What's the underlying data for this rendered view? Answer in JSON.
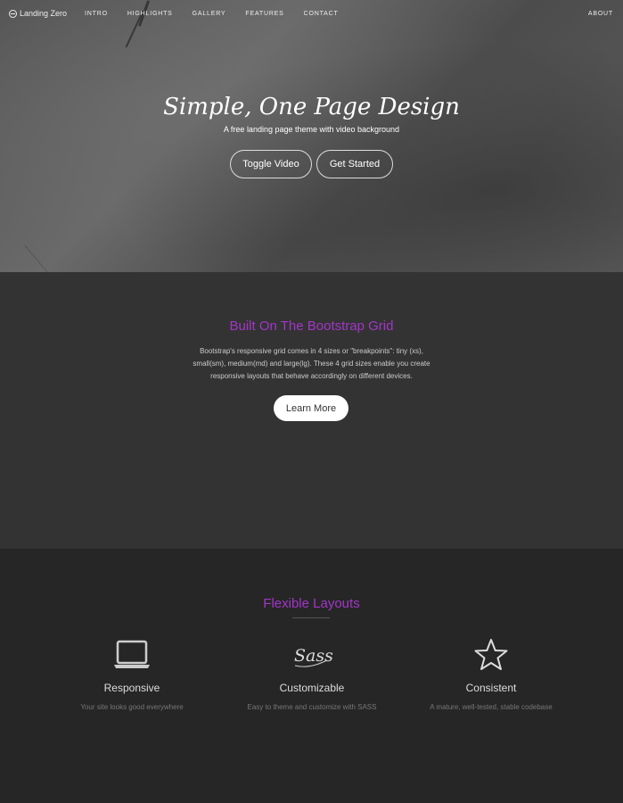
{
  "navbar": {
    "brand": "Landing Zero",
    "links": [
      "INTRO",
      "HIGHLIGHTS",
      "GALLERY",
      "FEATURES",
      "CONTACT"
    ],
    "right_link": "ABOUT",
    "logo_icon": "circle-minus-icon"
  },
  "hero": {
    "title": "Simple, One Page Design",
    "subtitle": "A free landing page theme with video background",
    "buttons": [
      "Toggle Video",
      "Get Started"
    ]
  },
  "grid_section": {
    "title": "Built On The Bootstrap Grid",
    "paragraph_lines": [
      "Bootstrap's responsive grid comes in 4 sizes or \"breakpoints\": tiny (xs),",
      "small(sm), medium(md) and large(lg). These 4 grid sizes enable you create",
      "responsive layouts that behave accordingly on different devices."
    ],
    "button": "Learn More",
    "accent_color": "#a335c9"
  },
  "layouts_section": {
    "title": "Flexible Layouts",
    "features": [
      {
        "icon": "laptop-icon",
        "title": "Responsive",
        "desc": "Your site looks good everywhere"
      },
      {
        "icon": "sass-logo-icon",
        "title": "Customizable",
        "desc": "Easy to theme and customize with SASS"
      },
      {
        "icon": "star-icon",
        "title": "Consistent",
        "desc": "A mature, well-tested, stable codebase"
      }
    ]
  }
}
